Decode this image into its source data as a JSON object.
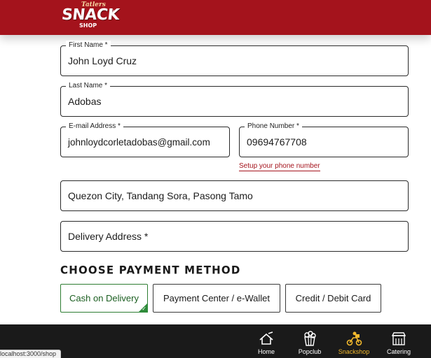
{
  "brand": {
    "tagline": "Tatlers",
    "name": "SNACK",
    "sub": "SHOP",
    "reg": "®"
  },
  "form": {
    "first_name": {
      "label": "First Name *",
      "value": "John Loyd Cruz"
    },
    "last_name": {
      "label": "Last Name *",
      "value": "Adobas"
    },
    "email": {
      "label": "E-mail Address *",
      "value": "johnloydcorletadobas@gmail.com"
    },
    "phone": {
      "label": "Phone Number *",
      "value": "09694767708"
    },
    "phone_link": "Setup your phone number",
    "address": {
      "value": "Quezon City, Tandang Sora, Pasong Tamo"
    },
    "delivery": {
      "placeholder": "Delivery Address *"
    }
  },
  "payment": {
    "title": "CHOOSE PAYMENT METHOD",
    "options": [
      {
        "label": "Cash on Delivery",
        "selected": true
      },
      {
        "label": "Payment Center / e-Wallet",
        "selected": false
      },
      {
        "label": "Credit / Debit Card",
        "selected": false
      }
    ],
    "check": "✓"
  },
  "nav": {
    "items": [
      {
        "label": "Home",
        "icon": "home-icon"
      },
      {
        "label": "Popclub",
        "icon": "popcorn-icon"
      },
      {
        "label": "Snackshop",
        "icon": "bike-icon",
        "active": true
      },
      {
        "label": "Catering",
        "icon": "catering-icon"
      }
    ]
  },
  "status_url": "localhost:3000/shop",
  "colors": {
    "brand_red": "#a4131c",
    "nav_bg": "#1a1a1a",
    "active": "#f1b82d",
    "selected_green": "#2e7d32"
  }
}
